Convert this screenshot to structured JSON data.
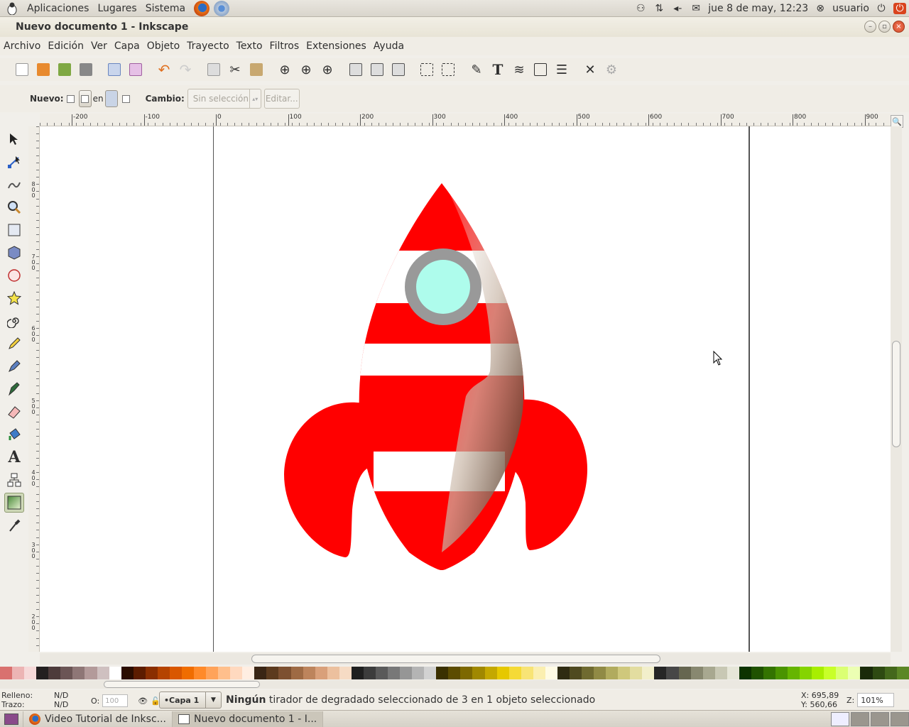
{
  "top_panel": {
    "menus": [
      "Aplicaciones",
      "Lugares",
      "Sistema"
    ],
    "launchers": [
      "firefox-icon",
      "chromium-icon"
    ],
    "datetime": "jue  8 de may, 12:23",
    "user": "usuario"
  },
  "window": {
    "title": "Nuevo documento 1 - Inkscape"
  },
  "menubar": [
    "Archivo",
    "Edición",
    "Ver",
    "Capa",
    "Objeto",
    "Trayecto",
    "Texto",
    "Filtros",
    "Extensiones",
    "Ayuda"
  ],
  "tool_controls": {
    "new_label": "Nuevo:",
    "on_label": "en",
    "change_label": "Cambio:",
    "selection_value": "Sin selección",
    "edit_label": "Editar..."
  },
  "ruler_labels": [
    "-200",
    "-100",
    "0",
    "100",
    "200",
    "300",
    "400",
    "500",
    "600",
    "700",
    "800",
    "900"
  ],
  "vruler_labels": [
    "800",
    "700",
    "600",
    "500",
    "400",
    "300",
    "200"
  ],
  "status": {
    "fill_label": "Relleno:",
    "fill_value": "N/D",
    "stroke_label": "Trazo:",
    "stroke_value": "N/D",
    "opacity_label": "O:",
    "opacity_value": "100",
    "layer": "•Capa 1",
    "message_bold": "Ningún",
    "message_rest": " tirador de degradado seleccionado de 3 en 1 objeto seleccionado",
    "x_label": "X:",
    "x_value": "695,89",
    "y_label": "Y:",
    "y_value": "560,66",
    "zoom_label": "Z:",
    "zoom_value": "101%"
  },
  "taskbar": {
    "tasks": [
      "Video Tutorial de Inksc...",
      "Nuevo documento 1 - I..."
    ]
  },
  "palette_colors": [
    "#d9716f",
    "#ecb4b4",
    "#f6d9d9",
    "#231f20",
    "#4d3b3b",
    "#6b5555",
    "#8e7676",
    "#b39a9a",
    "#cfc0c0",
    "#ffffff",
    "#2b0d00",
    "#5c1c00",
    "#8a2e00",
    "#b54300",
    "#d95700",
    "#f06d00",
    "#ff8a2a",
    "#ffa35a",
    "#ffbf8c",
    "#ffd9bf",
    "#ffeee2",
    "#3a2514",
    "#5c3a1e",
    "#7d5030",
    "#9e6a44",
    "#bd845c",
    "#d9a07a",
    "#ecc09e",
    "#f6dbc4",
    "#1f1f1f",
    "#3c3c3c",
    "#5a5a5a",
    "#787878",
    "#969696",
    "#b4b4b4",
    "#d2d2d2",
    "#3a3000",
    "#5c4c00",
    "#7d6800",
    "#a08800",
    "#c4a800",
    "#e6c800",
    "#f5da36",
    "#f8e475",
    "#fbefb0",
    "#fffbe4",
    "#2f2b12",
    "#4f4a20",
    "#6f6a30",
    "#908a45",
    "#b1ab5e",
    "#cfc87c",
    "#e3dda0",
    "#f2efcb",
    "#262626",
    "#474747",
    "#666650",
    "#888870",
    "#a8a890",
    "#c8c8b4",
    "#e6e6d8",
    "#0d3300",
    "#1f5200",
    "#337300",
    "#4a9400",
    "#66b500",
    "#85d400",
    "#a8ee00",
    "#c8ff29",
    "#dbff73",
    "#ecffb3",
    "#1a2b0a",
    "#2e4a12",
    "#44681c",
    "#5c8726"
  ]
}
